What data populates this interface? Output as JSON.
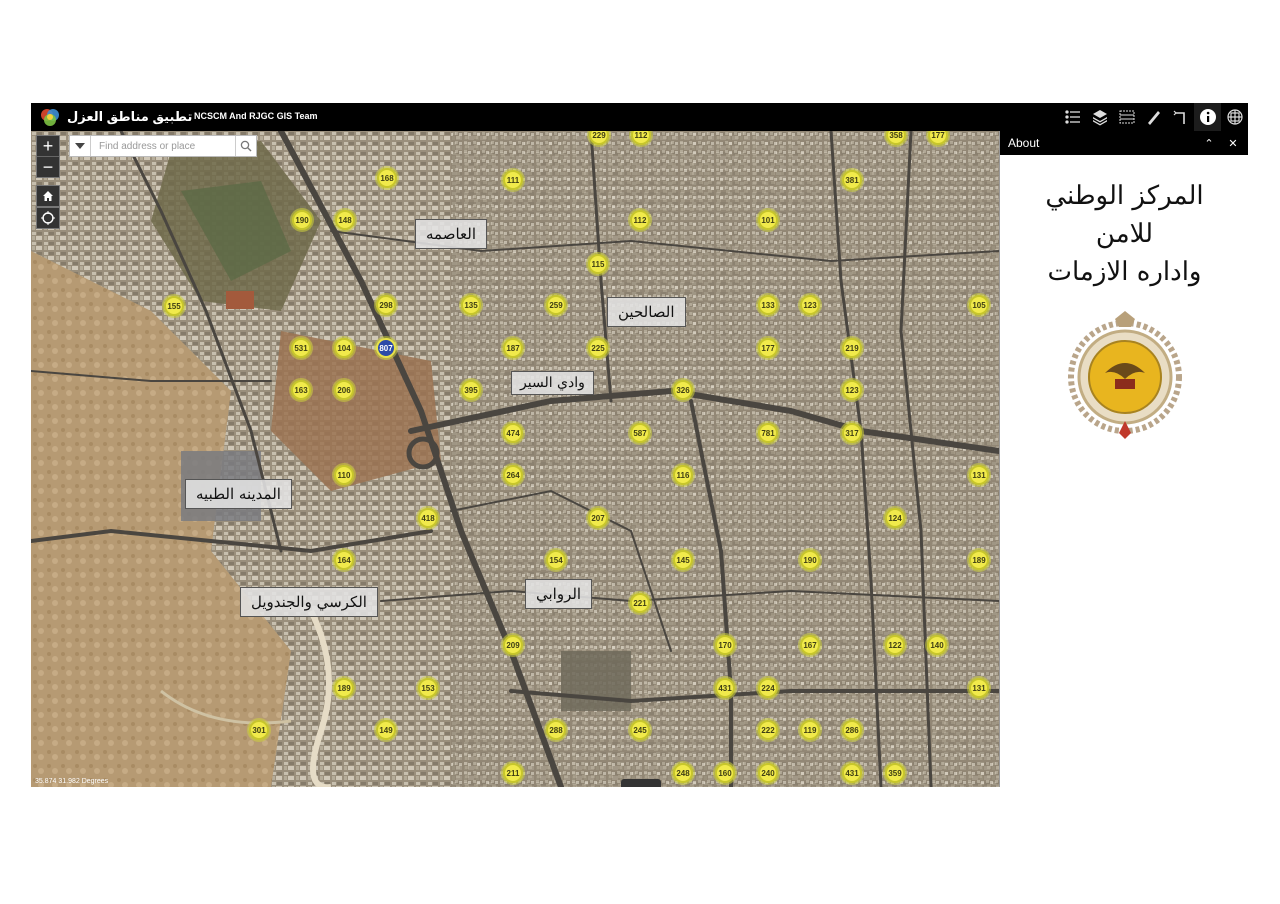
{
  "header": {
    "app_title": "تطبيق مناطق العزل",
    "subtitle": "NCSCM And RJGC GIS Team",
    "tools": [
      {
        "name": "legend-icon"
      },
      {
        "name": "layers-icon"
      },
      {
        "name": "attribute-table-icon"
      },
      {
        "name": "measure-icon"
      },
      {
        "name": "directions-icon"
      },
      {
        "name": "info-icon"
      },
      {
        "name": "basemap-gallery-icon"
      }
    ]
  },
  "map": {
    "search_placeholder": "Find address or place",
    "coords": "35.874 31.982 Degrees",
    "zoom_in": "+",
    "zoom_out": "−",
    "places": [
      "العاصمه",
      "الصالحين",
      "وادي السير",
      "المدينه الطبيه",
      "الكرسي والجندويل",
      "الروابي"
    ],
    "clusters": [
      {
        "label": "229"
      },
      {
        "label": "112"
      },
      {
        "label": "358"
      },
      {
        "label": "177"
      },
      {
        "label": "168"
      },
      {
        "label": "111"
      },
      {
        "label": "381"
      },
      {
        "label": "190"
      },
      {
        "label": "148"
      },
      {
        "label": "112"
      },
      {
        "label": "101"
      },
      {
        "label": "115"
      },
      {
        "label": "155"
      },
      {
        "label": "298"
      },
      {
        "label": "135"
      },
      {
        "label": "259"
      },
      {
        "label": "133"
      },
      {
        "label": "123"
      },
      {
        "label": "105"
      },
      {
        "label": "531"
      },
      {
        "label": "104"
      },
      {
        "label": "807"
      },
      {
        "label": "187"
      },
      {
        "label": "225"
      },
      {
        "label": "177"
      },
      {
        "label": "219"
      },
      {
        "label": "163"
      },
      {
        "label": "206"
      },
      {
        "label": "395"
      },
      {
        "label": "326"
      },
      {
        "label": "123"
      },
      {
        "label": "474"
      },
      {
        "label": "587"
      },
      {
        "label": "781"
      },
      {
        "label": "317"
      },
      {
        "label": "264"
      },
      {
        "label": "116"
      },
      {
        "label": "110"
      },
      {
        "label": "131"
      },
      {
        "label": "418"
      },
      {
        "label": "207"
      },
      {
        "label": "124"
      },
      {
        "label": "164"
      },
      {
        "label": "154"
      },
      {
        "label": "145"
      },
      {
        "label": "190"
      },
      {
        "label": "189"
      },
      {
        "label": "221"
      },
      {
        "label": "209"
      },
      {
        "label": "170"
      },
      {
        "label": "167"
      },
      {
        "label": "122"
      },
      {
        "label": "140"
      },
      {
        "label": "189"
      },
      {
        "label": "153"
      },
      {
        "label": "431"
      },
      {
        "label": "224"
      },
      {
        "label": "131"
      },
      {
        "label": "301"
      },
      {
        "label": "149"
      },
      {
        "label": "288"
      },
      {
        "label": "245"
      },
      {
        "label": "222"
      },
      {
        "label": "119"
      },
      {
        "label": "286"
      },
      {
        "label": "211"
      },
      {
        "label": "248"
      },
      {
        "label": "160"
      },
      {
        "label": "240"
      },
      {
        "label": "431"
      },
      {
        "label": "359"
      }
    ]
  },
  "panel": {
    "title": "About",
    "collapse": "⌃",
    "close": "✕",
    "about_lines": [
      "المركز الوطني",
      "للامن",
      "واداره الازمات"
    ]
  },
  "colors": {
    "cluster_fill": "#f1ea4b",
    "header_bg": "#000000",
    "highlight_cluster": "#2b4aa8"
  }
}
